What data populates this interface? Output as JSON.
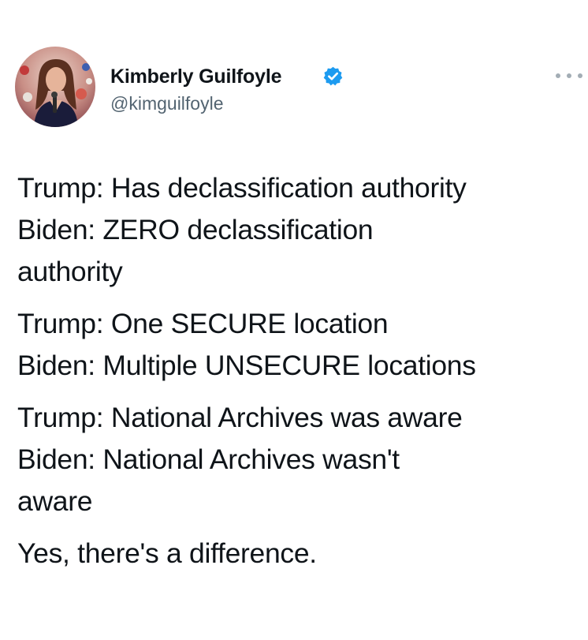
{
  "tweet": {
    "author": {
      "name": "Kimberly Guilfoyle",
      "handle": "@kimguilfoyle",
      "verified": true,
      "avatar": "avatar-photo"
    },
    "menu_icon": "more-horizontal-icon",
    "colors": {
      "text": "#0f1419",
      "secondary_text": "#536471",
      "verified_badge": "#1d9bf0",
      "background": "#ffffff"
    },
    "paragraphs": [
      {
        "lines": [
          "Trump: Has declassification authority",
          "Biden: ZERO declassification",
          "authority"
        ]
      },
      {
        "lines": [
          "Trump: One SECURE location",
          "Biden: Multiple UNSECURE locations"
        ]
      },
      {
        "lines": [
          "Trump: National Archives was aware",
          "Biden: National Archives wasn't",
          "aware"
        ]
      },
      {
        "lines": [
          "Yes, there's a difference."
        ]
      }
    ]
  }
}
